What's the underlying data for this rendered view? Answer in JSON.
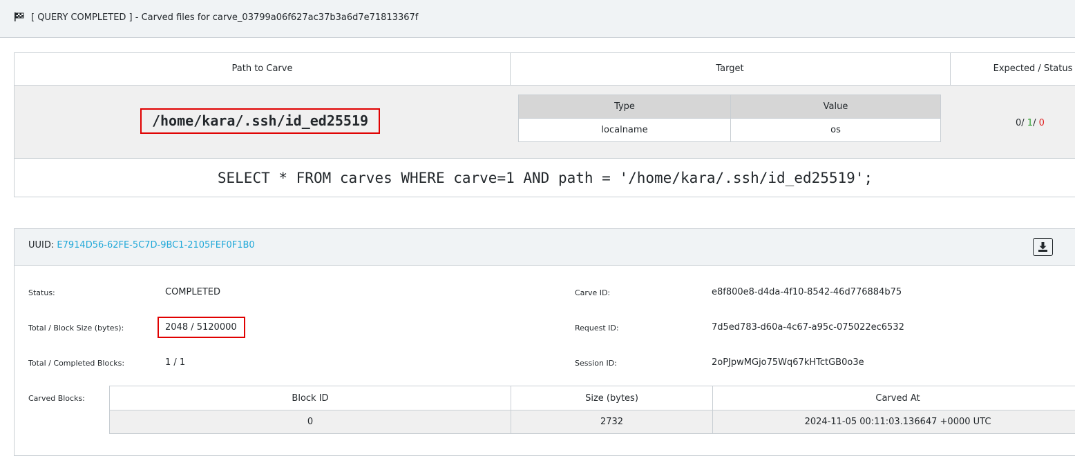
{
  "header": {
    "status": "[ QUERY COMPLETED ]",
    "subtitle": "- Carved files for carve_03799a06f627ac37b3a6d7e71813367f"
  },
  "query": {
    "columns": [
      "Path to Carve",
      "Target",
      "Expected / Status"
    ],
    "path": "/home/kara/.ssh/id_ed25519",
    "target_columns": [
      "Type",
      "Value"
    ],
    "target_rows": [
      {
        "type": "localname",
        "value": "os"
      }
    ],
    "expected": {
      "a": "0",
      "b": "1",
      "c": "0"
    },
    "sql": "SELECT * FROM carves WHERE carve=1 AND path = '/home/kara/.ssh/id_ed25519';"
  },
  "carve": {
    "uuid_label": "UUID:",
    "uuid": "E7914D56-62FE-5C7D-9BC1-2105FEF0F1B0",
    "fields_left": [
      {
        "label": "Status:",
        "value": "COMPLETED"
      },
      {
        "label": "Total / Block Size (bytes):",
        "value": "2048 / 5120000"
      },
      {
        "label": "Total / Completed Blocks:",
        "value": "1 / 1"
      }
    ],
    "fields_right": [
      {
        "label": "Carve ID:",
        "value": "e8f800e8-d4da-4f10-8542-46d776884b75"
      },
      {
        "label": "Request ID:",
        "value": "7d5ed783-d60a-4c67-a95c-075022ec6532"
      },
      {
        "label": "Session ID:",
        "value": "2oPJpwMGjo75Wq67kHTctGB0o3e"
      }
    ],
    "blocks_label": "Carved Blocks:",
    "blocks_columns": [
      "Block ID",
      "Size (bytes)",
      "Carved At"
    ],
    "blocks": [
      {
        "id": "0",
        "size": "2732",
        "carved_at": "2024-11-05 00:11:03.136647 +0000 UTC"
      }
    ]
  }
}
